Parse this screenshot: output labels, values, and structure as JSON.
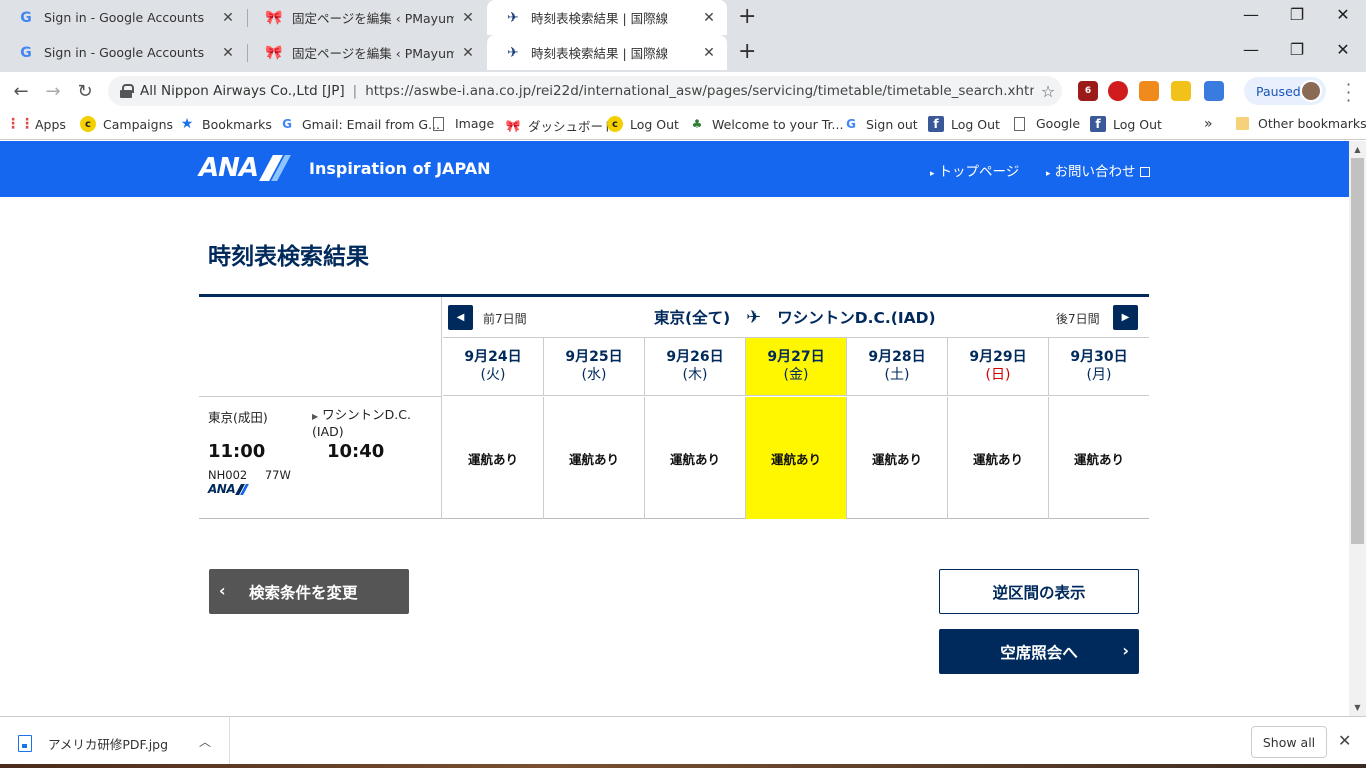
{
  "tabs_row1": [
    {
      "title": "Sign in - Google Accounts",
      "favicon": "G"
    },
    {
      "title": "固定ページを編集 ‹ PMayumi.com —",
      "favicon": "ribbon"
    },
    {
      "title": "時刻表検索結果 | 国際線",
      "favicon": "ana-tag"
    }
  ],
  "tabs_row2": [
    {
      "title": "Sign in - Google Accounts",
      "favicon": "G"
    },
    {
      "title": "固定ページを編集 ‹ PMayumi.com —",
      "favicon": "ribbon"
    },
    {
      "title": "時刻表検索結果 | 国際線",
      "favicon": "ana-tag"
    }
  ],
  "toolbar": {
    "site_org": "All Nippon Airways Co.,Ltd [JP]",
    "url": "https://aswbe-i.ana.co.jp/rei22d/international_asw/pages/servicing/timetable/timetable_search.xhtml?aswci...",
    "profile_status": "Paused",
    "ext_badge": "6"
  },
  "bookmarks": [
    {
      "label": "Apps",
      "icon": "apps-grid-icon"
    },
    {
      "label": "Campaigns",
      "icon": "mailchimp-icon"
    },
    {
      "label": "Bookmarks",
      "icon": "star-icon"
    },
    {
      "label": "Gmail: Email from G...",
      "icon": "google-icon"
    },
    {
      "label": "Image",
      "icon": "page-icon"
    },
    {
      "label": "ダッシュボード",
      "icon": "ribbon-icon"
    },
    {
      "label": "Log Out",
      "icon": "mailchimp-icon"
    },
    {
      "label": "Welcome to your Tr...",
      "icon": "leaf-icon"
    },
    {
      "label": "Sign out",
      "icon": "google-icon"
    },
    {
      "label": "Log Out",
      "icon": "facebook-icon"
    },
    {
      "label": "Google",
      "icon": "page-icon"
    },
    {
      "label": "Log Out",
      "icon": "facebook-icon"
    }
  ],
  "bookmarks_more": "»",
  "other_bookmarks": "Other bookmarks",
  "header": {
    "logo": "ANA",
    "tagline": "Inspiration of JAPAN",
    "link_top": "トップページ",
    "link_contact": "お問い合わせ"
  },
  "page_title": "時刻表検索結果",
  "route": {
    "prev_label": "前7日間",
    "next_label": "後7日間",
    "origin": "東京(全て)",
    "destination": "ワシントンD.C.(IAD)"
  },
  "days": [
    {
      "date": "9月24日",
      "weekday": "(火)"
    },
    {
      "date": "9月25日",
      "weekday": "(水)"
    },
    {
      "date": "9月26日",
      "weekday": "(木)"
    },
    {
      "date": "9月27日",
      "weekday": "(金)"
    },
    {
      "date": "9月28日",
      "weekday": "(土)"
    },
    {
      "date": "9月29日",
      "weekday": "(日)"
    },
    {
      "date": "9月30日",
      "weekday": "(月)"
    }
  ],
  "selected_day_index": 3,
  "highlight_color": "#fff700",
  "flight": {
    "origin": "東京(成田)",
    "destination": "ワシントンD.C.(IAD)",
    "departure": "11:00",
    "arrival": "10:40",
    "flight_no": "NH002",
    "aircraft": "77W",
    "carrier_logo": "ANA",
    "status": [
      "運航あり",
      "運航あり",
      "運航あり",
      "運航あり",
      "運航あり",
      "運航あり",
      "運航あり"
    ]
  },
  "buttons": {
    "back": "検索条件を変更",
    "reverse": "逆区間の表示",
    "seat": "空席照会へ"
  },
  "download": {
    "filename": "アメリカ研修PDF.jpg",
    "show_all": "Show all"
  },
  "colors": {
    "ana_blue": "#1667f0",
    "ana_navy": "#00295c",
    "sunday_red": "#cc0000"
  }
}
